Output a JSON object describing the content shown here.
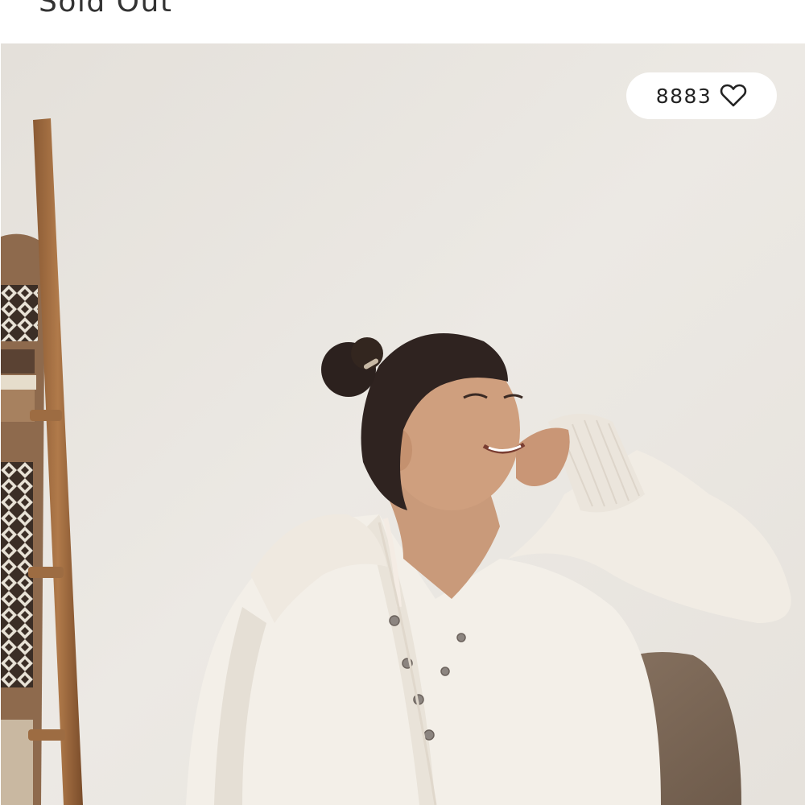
{
  "product": {
    "status_label": "Sold Out"
  },
  "likes": {
    "count": "8883",
    "icon": "heart-outline-icon"
  },
  "colors": {
    "background": "#ffffff",
    "wall": "#e9e6e1",
    "text": "#222222"
  }
}
